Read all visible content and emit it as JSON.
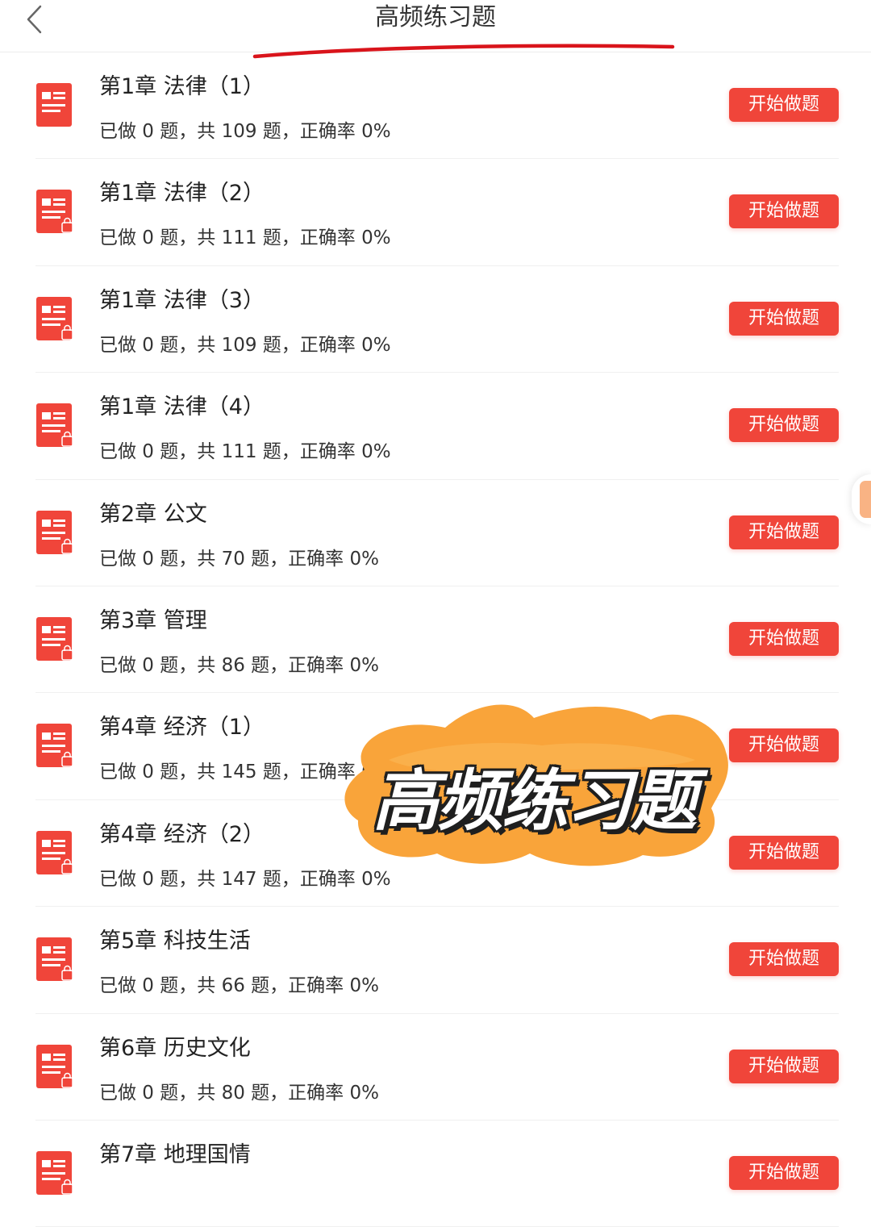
{
  "header": {
    "title": "高频练习题",
    "back_icon": "chevron-left-icon"
  },
  "colors": {
    "accent": "#f0453a",
    "sticker": "#f9a43a",
    "underline": "#d9141b"
  },
  "button_label": "开始做题",
  "items": [
    {
      "title": "第1章 法律（1）",
      "stats": "已做 0 题，共 109 题，正确率 0%",
      "locked": false
    },
    {
      "title": "第1章 法律（2）",
      "stats": "已做 0 题，共 111 题，正确率 0%",
      "locked": true
    },
    {
      "title": "第1章 法律（3）",
      "stats": "已做 0 题，共 109 题，正确率 0%",
      "locked": true
    },
    {
      "title": "第1章 法律（4）",
      "stats": "已做 0 题，共 111 题，正确率 0%",
      "locked": true
    },
    {
      "title": "第2章 公文",
      "stats": "已做 0 题，共 70 题，正确率 0%",
      "locked": true
    },
    {
      "title": "第3章 管理",
      "stats": "已做 0 题，共 86 题，正确率 0%",
      "locked": true
    },
    {
      "title": "第4章 经济（1）",
      "stats": "已做 0 题，共 145 题，正确率 0%",
      "locked": true
    },
    {
      "title": "第4章 经济（2）",
      "stats": "已做 0 题，共 147 题，正确率 0%",
      "locked": true
    },
    {
      "title": "第5章 科技生活",
      "stats": "已做 0 题，共 66 题，正确率 0%",
      "locked": true
    },
    {
      "title": "第6章 历史文化",
      "stats": "已做 0 题，共 80 题，正确率 0%",
      "locked": true
    },
    {
      "title": "第7章 地理国情",
      "stats": "",
      "locked": true
    }
  ],
  "overlay": {
    "text": "高频练习题"
  }
}
